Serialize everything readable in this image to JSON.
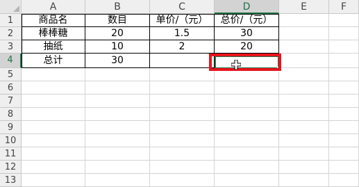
{
  "columns": [
    "A",
    "B",
    "C",
    "D",
    "E",
    "F"
  ],
  "rows": [
    "1",
    "2",
    "3",
    "4",
    "5",
    "6",
    "7",
    "8",
    "9",
    "10",
    "11",
    "12",
    "13"
  ],
  "cells": {
    "r1": [
      "商品名",
      "数目",
      "单价/（元）",
      "总价/（元）"
    ],
    "r2": [
      "棒棒糖",
      "20",
      "1.5",
      "30"
    ],
    "r3": [
      "抽纸",
      "10",
      "2",
      "20"
    ],
    "r4": [
      "总计",
      "30",
      "",
      ""
    ]
  },
  "selection": {
    "active_cell": "D4",
    "active_column": "D",
    "active_row": "4"
  },
  "colors": {
    "selection": "#217346",
    "highlight": "#e8141c"
  },
  "cursor_icon": "plus-cursor-icon"
}
